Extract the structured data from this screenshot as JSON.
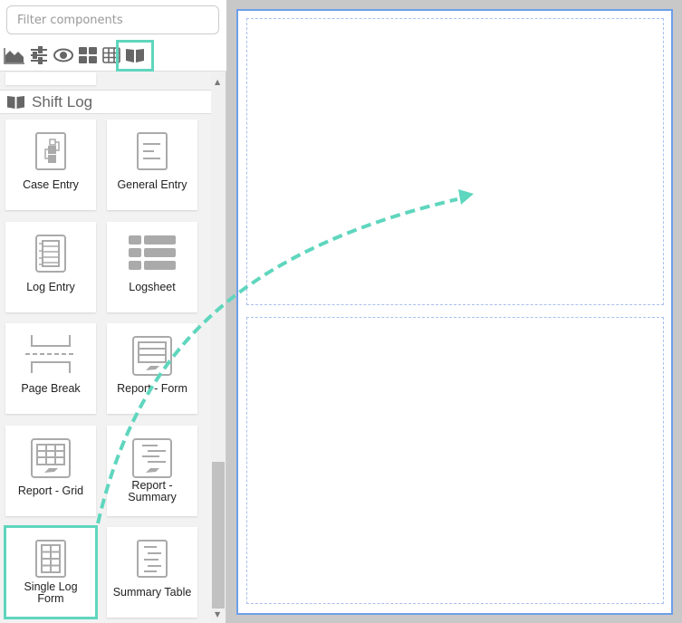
{
  "filter": {
    "placeholder": "Filter components",
    "value": ""
  },
  "toolbar": [
    {
      "icon": "area-chart-icon"
    },
    {
      "icon": "sliders-icon"
    },
    {
      "icon": "eye-icon"
    },
    {
      "icon": "dashboard-tiles-icon"
    },
    {
      "icon": "table-icon"
    },
    {
      "icon": "book-icon",
      "selected": true
    }
  ],
  "section": {
    "title": "Shift Log",
    "icon": "book-icon"
  },
  "components": [
    {
      "label": "Case Entry",
      "icon": "case-entry-icon"
    },
    {
      "label": "General Entry",
      "icon": "general-entry-icon"
    },
    {
      "label": "Log Entry",
      "icon": "log-entry-icon"
    },
    {
      "label": "Logsheet",
      "icon": "logsheet-icon"
    },
    {
      "label": "Page Break",
      "icon": "page-break-icon"
    },
    {
      "label": "Report - Form",
      "icon": "report-form-icon"
    },
    {
      "label": "Report - Grid",
      "icon": "report-grid-icon"
    },
    {
      "label": "Report - Summary",
      "icon": "report-summary-icon"
    },
    {
      "label": "Single Log Form",
      "icon": "single-log-form-icon",
      "selected": true
    },
    {
      "label": "Summary Table",
      "icon": "summary-table-icon"
    }
  ],
  "colors": {
    "accent": "#5fd6be",
    "canvas_border": "#6d9eeb",
    "zone_border": "#a9c0ef"
  }
}
